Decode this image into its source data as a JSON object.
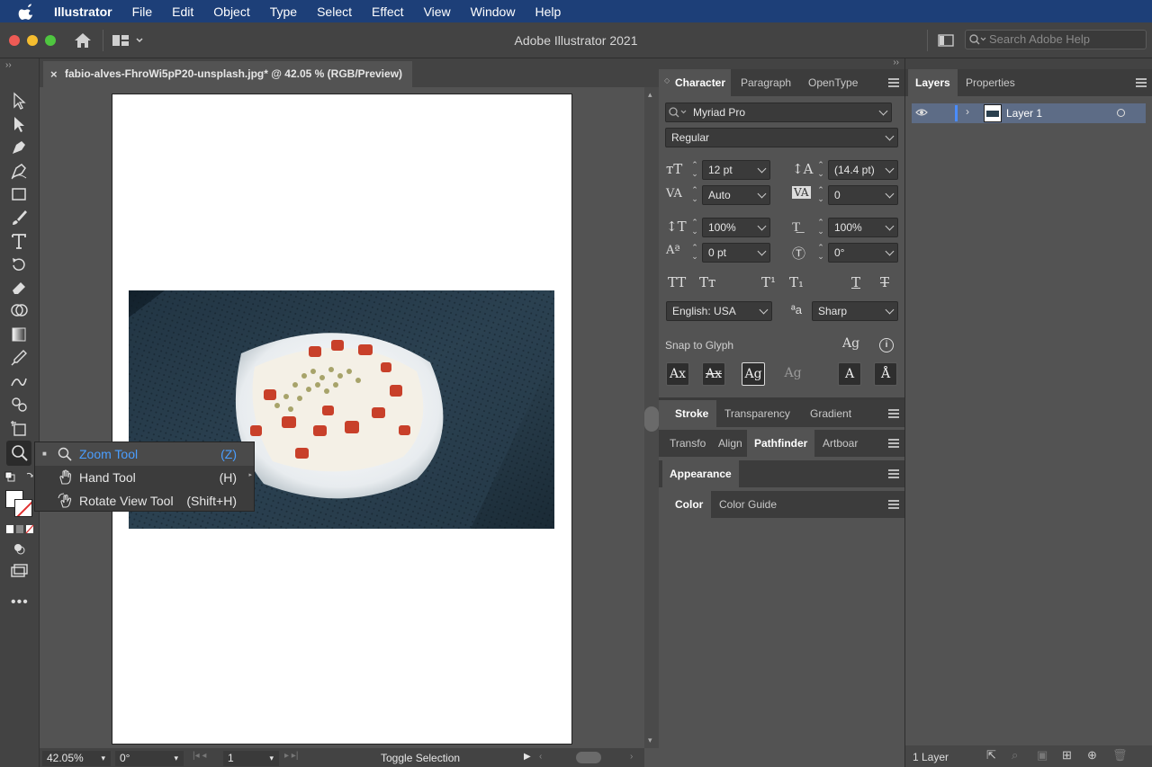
{
  "menubar": {
    "app_name": "Illustrator",
    "items": [
      "File",
      "Edit",
      "Object",
      "Type",
      "Select",
      "Effect",
      "View",
      "Window",
      "Help"
    ]
  },
  "titlebar": {
    "title": "Adobe Illustrator 2021",
    "search_placeholder": "Search Adobe Help"
  },
  "document": {
    "tab_title": "fabio-alves-FhroWi5pP20-unsplash.jpg* @ 42.05 % (RGB/Preview)"
  },
  "flyout": {
    "items": [
      {
        "label": "Zoom Tool",
        "shortcut": "(Z)",
        "icon": "zoom-icon",
        "selected": true
      },
      {
        "label": "Hand Tool",
        "shortcut": "(H)",
        "icon": "hand-icon",
        "selected": false
      },
      {
        "label": "Rotate View Tool",
        "shortcut": "(Shift+H)",
        "icon": "rotate-view-icon",
        "selected": false
      }
    ]
  },
  "statusbar": {
    "zoom": "42.05%",
    "rotation": "0°",
    "artboard": "1",
    "status_text": "Toggle Selection"
  },
  "character_panel": {
    "tabs": [
      "Character",
      "Paragraph",
      "OpenType"
    ],
    "font_family": "Myriad Pro",
    "font_style": "Regular",
    "font_size": "12 pt",
    "leading": "(14.4 pt)",
    "kerning": "Auto",
    "tracking": "0",
    "vertical_scale": "100%",
    "horizontal_scale": "100%",
    "baseline_shift": "0 pt",
    "rotation": "0°",
    "language": "English: USA",
    "antialiasing": "Sharp",
    "snap_label": "Snap to Glyph"
  },
  "stroke_group": {
    "tabs": [
      "Stroke",
      "Transparency",
      "Gradient"
    ]
  },
  "pathfinder_group": {
    "tabs": [
      "Transfo",
      "Align",
      "Pathfinder",
      "Artboar"
    ]
  },
  "appearance_group": {
    "tabs": [
      "Appearance"
    ]
  },
  "color_group": {
    "tabs": [
      "Color",
      "Color Guide"
    ]
  },
  "layers_panel": {
    "tabs": [
      "Layers",
      "Properties"
    ],
    "layer_name": "Layer 1",
    "footer_count": "1 Layer"
  },
  "colors": {
    "accent": "#4a9eff",
    "menubar": "#1d3f78",
    "panel": "#535353",
    "dark": "#434343"
  }
}
